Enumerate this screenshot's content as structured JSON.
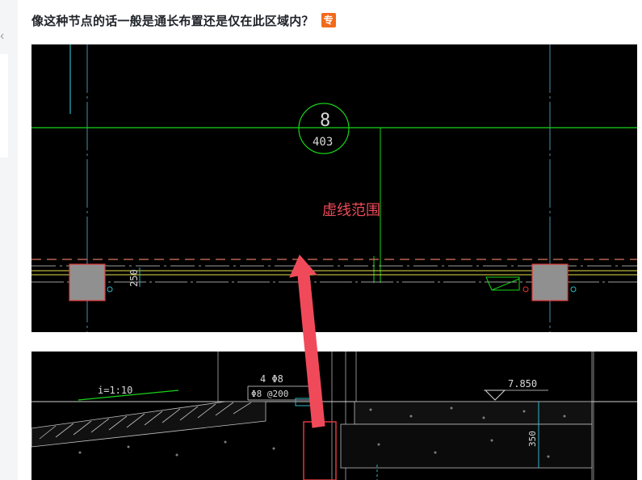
{
  "question": {
    "title": "像这种节点的话一般是通长布置还是仅在此区域内？",
    "badge": "专"
  },
  "nav": {
    "back_glyph": "‹"
  },
  "drawing_top": {
    "circle_top": "8",
    "circle_bottom": "403",
    "dim_label": "250",
    "annotation": "虚线范围"
  },
  "drawing_bottom": {
    "slope_label": "i=1:10",
    "rebar_count": "4 Φ8",
    "stirrup": "Φ8 @200",
    "elevation": "7.850",
    "height_dim": "350"
  },
  "colors": {
    "annotation_red": "#f04a5a",
    "cad_green": "#19d419",
    "cad_cyan": "#2fb6c9",
    "badge_orange": "#f26a1b"
  }
}
